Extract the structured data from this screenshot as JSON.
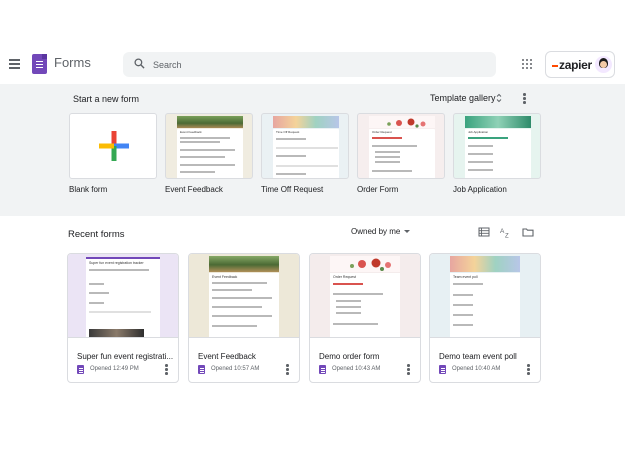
{
  "header": {
    "app_title": "Forms",
    "search_placeholder": "Search",
    "account_label": "zapier"
  },
  "templates": {
    "section_title": "Start a new form",
    "gallery_label": "Template gallery",
    "items": [
      {
        "label": "Blank form",
        "icon": "plus-icon"
      },
      {
        "label": "Event Feedback",
        "mini_title": "Event Feedback"
      },
      {
        "label": "Time Off Request",
        "mini_title": "Time Off Request"
      },
      {
        "label": "Order Form",
        "mini_title": "Order Request"
      },
      {
        "label": "Job Application",
        "mini_title": "Job Application"
      }
    ]
  },
  "recent": {
    "section_title": "Recent forms",
    "owner_filter": "Owned by me",
    "tools": [
      "list-view-icon",
      "sort-az-icon",
      "folder-icon"
    ],
    "forms": [
      {
        "title": "Super fun event registrati...",
        "opened": "Opened 12:49 PM",
        "mini_title": "Super fun event registration tracker"
      },
      {
        "title": "Event Feedback",
        "opened": "Opened 10:57 AM",
        "mini_title": "Event Feedback"
      },
      {
        "title": "Demo order form",
        "opened": "Opened 10:43 AM",
        "mini_title": "Order Request"
      },
      {
        "title": "Demo team event poll",
        "opened": "Opened 10:40 AM",
        "mini_title": "Team event poll"
      }
    ]
  },
  "colors": {
    "forms_purple": "#7248b9",
    "band_gray": "#f1f3f4",
    "zapier_orange": "#ff4a00"
  }
}
